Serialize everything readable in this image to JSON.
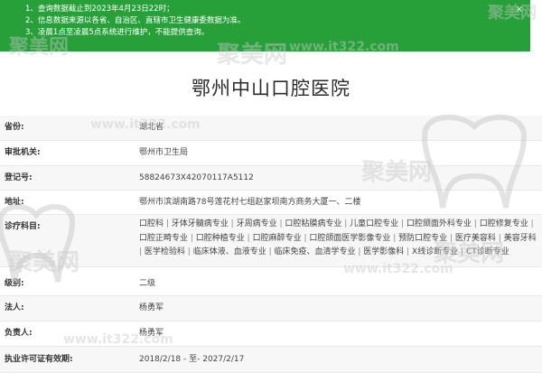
{
  "notice": {
    "lines": [
      "1、查询数据截止到2023年4月23日22时；",
      "2、信息数据来源以各省、自治区、直辖市卫生健康委数据为准。",
      "3、凌晨1点至凌晨5点系统进行维护，不能提供查询。"
    ],
    "close": "×"
  },
  "title": "鄂州中山口腔医院",
  "rows": [
    {
      "label": "省份:",
      "value": "湖北省"
    },
    {
      "label": "审批机关:",
      "value": "鄂州市卫生局"
    },
    {
      "label": "登记号:",
      "value": "58824673X42070117A5112"
    },
    {
      "label": "地址:",
      "value": "鄂州市滨湖南路78号莲花村七组赵家坝南方商务大厦一、二楼"
    }
  ],
  "majors_label": "诊疗科目:",
  "majors": [
    "口腔科",
    "牙体牙髓病专业",
    "牙周病专业",
    "口腔粘膜病专业",
    "儿童口腔专业",
    "口腔颌面外科专业",
    "口腔修复专业",
    "口腔正畸专业",
    "口腔种植专业",
    "口腔麻醉专业",
    "口腔颌面医学影像专业",
    "预防口腔专业",
    "医疗美容科",
    "美容牙科",
    "医学检验科",
    "临床体液、血液专业",
    "临床免疫、血清学专业",
    "医学影像科",
    "X线诊断专业",
    "CT诊断专业"
  ],
  "rows2": [
    {
      "label": "级别:",
      "value": "二级"
    },
    {
      "label": "法人:",
      "value": "杨勇军"
    },
    {
      "label": "负责人:",
      "value": "杨勇军"
    },
    {
      "label": "执业许可证有效期:",
      "value": "2018/2/18 - 至- 2027/2/17"
    }
  ],
  "watermarks": {
    "brand": "聚美网",
    "url": "www.it322.com"
  }
}
